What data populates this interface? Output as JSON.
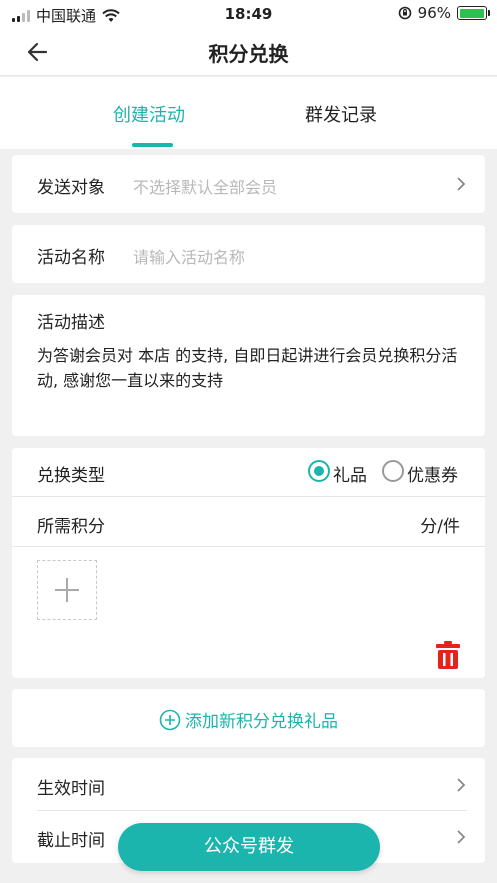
{
  "status_bar": {
    "carrier": "中国联通",
    "time": "18:49",
    "battery_percent": "96%",
    "battery_level": 0.96,
    "icons": [
      "signal-icon",
      "wifi-icon",
      "orientation-lock-icon",
      "battery-icon"
    ]
  },
  "header": {
    "title": "积分兑换",
    "back_icon": "back-arrow-icon"
  },
  "tabs": [
    {
      "label": "创建活动",
      "active": true
    },
    {
      "label": "群发记录",
      "active": false
    }
  ],
  "form": {
    "target": {
      "label": "发送对象",
      "placeholder": "不选择默认全部会员"
    },
    "activity_name": {
      "label": "活动名称",
      "placeholder": "请输入活动名称"
    },
    "description": {
      "label": "活动描述",
      "value": "为答谢会员对 本店 的支持, 自即日起讲进行会员兑换积分活动, 感谢您一直以来的支持"
    },
    "exchange_type": {
      "label": "兑换类型",
      "options": [
        {
          "label": "礼品",
          "selected": true
        },
        {
          "label": "优惠券",
          "selected": false
        }
      ]
    },
    "points_required": {
      "label": "所需积分",
      "unit": "分/件"
    },
    "add_gift": {
      "label": "添加新积分兑换礼品"
    },
    "effective_time": {
      "label": "生效时间"
    },
    "end_time": {
      "label": "截止时间"
    }
  },
  "actions": {
    "broadcast": "公众号群发"
  },
  "colors": {
    "accent": "#1bb5ad",
    "delete": "#e0261b",
    "placeholder": "#b8b8b8"
  }
}
